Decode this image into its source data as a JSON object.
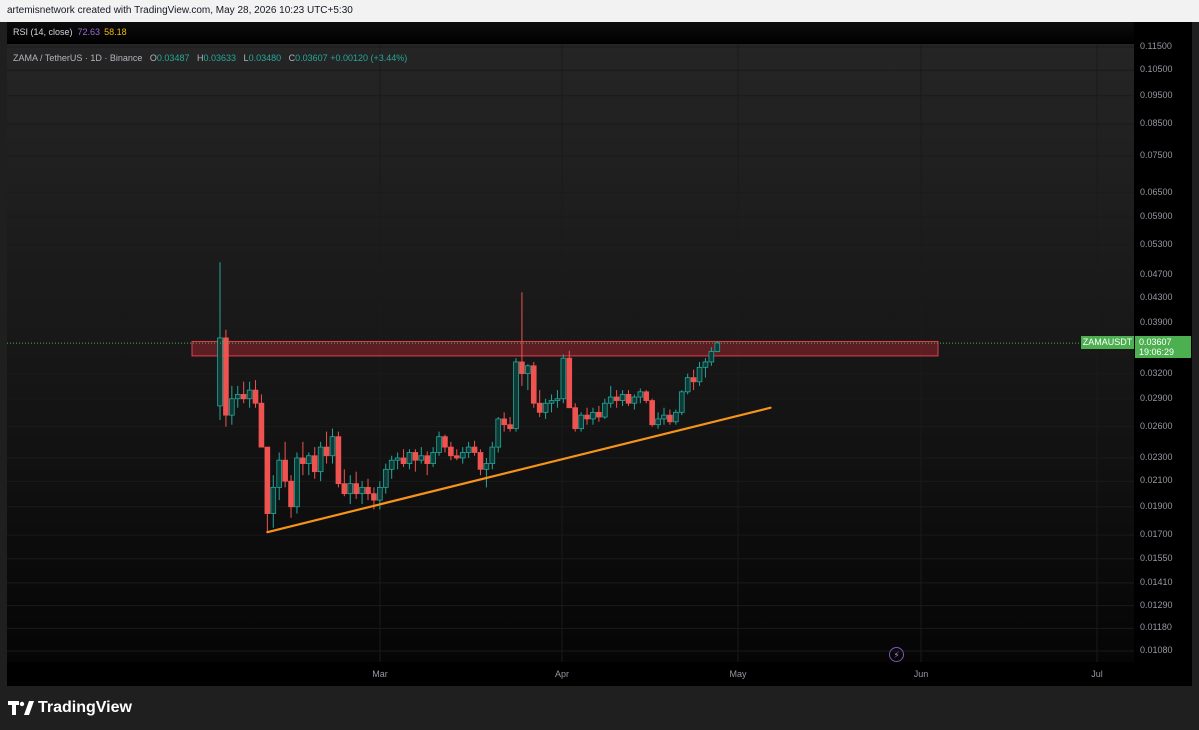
{
  "header": {
    "attribution": "artemisnetwork created with TradingView.com, May 28, 2026 10:23 UTC+5:30"
  },
  "rsi": {
    "label": "RSI (14, close)",
    "value": "72.63",
    "ma_value": "58.18"
  },
  "symbol": {
    "title": "ZAMA / TetherUS · 1D · Binance",
    "o_label": "O",
    "o_value": "0.03487",
    "h_label": "H",
    "h_value": "0.03633",
    "l_label": "L",
    "l_value": "0.03480",
    "c_label": "C",
    "c_value": "0.03607",
    "change": "+0.00120 (+3.44%)"
  },
  "price_tag": {
    "symbol": "ZAMAUSDT",
    "price": "0.03607",
    "countdown": "19:06:29"
  },
  "footer": {
    "brand": "TradingView"
  },
  "colors": {
    "up": "#26a69a",
    "down": "#ef5350",
    "trendline": "#f7931a",
    "resistance_zone": "#b22833",
    "price_tag": "#4caf50"
  },
  "chart_data": {
    "type": "candlestick",
    "scale": "log",
    "y_tick_labels": [
      "0.11500",
      "0.10500",
      "0.09500",
      "0.08500",
      "0.07500",
      "0.06500",
      "0.05900",
      "0.05300",
      "0.04700",
      "0.04300",
      "0.03900",
      "0.03200",
      "0.02900",
      "0.02600",
      "0.02300",
      "0.02100",
      "0.01900",
      "0.01700",
      "0.01550",
      "0.01410",
      "0.01290",
      "0.01180",
      "0.01080"
    ],
    "x_tick_labels": [
      "Mar",
      "Apr",
      "May",
      "Jun",
      "Jul"
    ],
    "last_price": 0.03607,
    "ohlc": [
      [
        0.0282,
        0.0495,
        0.0267,
        0.0368
      ],
      [
        0.0368,
        0.038,
        0.026,
        0.0272
      ],
      [
        0.0272,
        0.0305,
        0.0262,
        0.029
      ],
      [
        0.029,
        0.0305,
        0.028,
        0.0295
      ],
      [
        0.0295,
        0.031,
        0.0285,
        0.029
      ],
      [
        0.029,
        0.031,
        0.028,
        0.03
      ],
      [
        0.03,
        0.0312,
        0.028,
        0.0285
      ],
      [
        0.0285,
        0.0295,
        0.024,
        0.024
      ],
      [
        0.024,
        0.024,
        0.0172,
        0.0185
      ],
      [
        0.0185,
        0.0215,
        0.0175,
        0.0205
      ],
      [
        0.0205,
        0.0235,
        0.0195,
        0.0228
      ],
      [
        0.0228,
        0.0245,
        0.0205,
        0.021
      ],
      [
        0.021,
        0.0215,
        0.0182,
        0.019
      ],
      [
        0.019,
        0.0235,
        0.0185,
        0.023
      ],
      [
        0.023,
        0.0245,
        0.0215,
        0.0225
      ],
      [
        0.0225,
        0.0235,
        0.0215,
        0.0232
      ],
      [
        0.0232,
        0.024,
        0.0212,
        0.0218
      ],
      [
        0.0218,
        0.0245,
        0.021,
        0.024
      ],
      [
        0.024,
        0.0255,
        0.0225,
        0.0232
      ],
      [
        0.0232,
        0.0258,
        0.0225,
        0.025
      ],
      [
        0.025,
        0.0255,
        0.0205,
        0.0208
      ],
      [
        0.0208,
        0.022,
        0.0198,
        0.02
      ],
      [
        0.02,
        0.0215,
        0.0192,
        0.0208
      ],
      [
        0.0208,
        0.0218,
        0.0196,
        0.02
      ],
      [
        0.02,
        0.021,
        0.0192,
        0.0205
      ],
      [
        0.0205,
        0.0212,
        0.0195,
        0.02
      ],
      [
        0.02,
        0.0205,
        0.0188,
        0.0195
      ],
      [
        0.0195,
        0.021,
        0.0188,
        0.0205
      ],
      [
        0.0205,
        0.0225,
        0.02,
        0.022
      ],
      [
        0.022,
        0.0232,
        0.0212,
        0.0228
      ],
      [
        0.0228,
        0.0235,
        0.022,
        0.023
      ],
      [
        0.023,
        0.0238,
        0.0222,
        0.0225
      ],
      [
        0.0225,
        0.0238,
        0.022,
        0.0235
      ],
      [
        0.0235,
        0.0238,
        0.0218,
        0.0228
      ],
      [
        0.0228,
        0.024,
        0.0225,
        0.0232
      ],
      [
        0.0232,
        0.0236,
        0.0215,
        0.0225
      ],
      [
        0.0225,
        0.024,
        0.0222,
        0.0235
      ],
      [
        0.0235,
        0.0255,
        0.0232,
        0.025
      ],
      [
        0.025,
        0.0252,
        0.0235,
        0.024
      ],
      [
        0.024,
        0.0245,
        0.0228,
        0.0232
      ],
      [
        0.0232,
        0.0238,
        0.0228,
        0.023
      ],
      [
        0.023,
        0.024,
        0.0225,
        0.0235
      ],
      [
        0.0235,
        0.0245,
        0.023,
        0.024
      ],
      [
        0.024,
        0.0246,
        0.0232,
        0.0235
      ],
      [
        0.0235,
        0.0238,
        0.0215,
        0.022
      ],
      [
        0.022,
        0.023,
        0.0205,
        0.0225
      ],
      [
        0.0225,
        0.0245,
        0.022,
        0.024
      ],
      [
        0.024,
        0.027,
        0.0235,
        0.0268
      ],
      [
        0.0268,
        0.0275,
        0.0255,
        0.0262
      ],
      [
        0.0262,
        0.027,
        0.0255,
        0.0258
      ],
      [
        0.0258,
        0.034,
        0.0255,
        0.0335
      ],
      [
        0.0335,
        0.044,
        0.0305,
        0.032
      ],
      [
        0.032,
        0.0332,
        0.03,
        0.033
      ],
      [
        0.033,
        0.0335,
        0.028,
        0.0285
      ],
      [
        0.0285,
        0.03,
        0.027,
        0.0275
      ],
      [
        0.0275,
        0.029,
        0.0268,
        0.0285
      ],
      [
        0.0285,
        0.0295,
        0.0275,
        0.0288
      ],
      [
        0.0288,
        0.03,
        0.028,
        0.029
      ],
      [
        0.029,
        0.0345,
        0.0285,
        0.034
      ],
      [
        0.034,
        0.035,
        0.028,
        0.028
      ],
      [
        0.028,
        0.0285,
        0.0255,
        0.0258
      ],
      [
        0.0258,
        0.0275,
        0.0255,
        0.0272
      ],
      [
        0.0272,
        0.028,
        0.0262,
        0.0268
      ],
      [
        0.0268,
        0.028,
        0.0262,
        0.0275
      ],
      [
        0.0275,
        0.0282,
        0.0265,
        0.027
      ],
      [
        0.027,
        0.029,
        0.0268,
        0.0285
      ],
      [
        0.0285,
        0.0305,
        0.028,
        0.0292
      ],
      [
        0.0292,
        0.03,
        0.028,
        0.0288
      ],
      [
        0.0288,
        0.03,
        0.0282,
        0.0295
      ],
      [
        0.0295,
        0.03,
        0.0282,
        0.0285
      ],
      [
        0.0285,
        0.0295,
        0.0278,
        0.0292
      ],
      [
        0.0292,
        0.0302,
        0.0285,
        0.0298
      ],
      [
        0.0298,
        0.03,
        0.0285,
        0.0288
      ],
      [
        0.0288,
        0.029,
        0.026,
        0.0262
      ],
      [
        0.0262,
        0.0275,
        0.0258,
        0.0268
      ],
      [
        0.0268,
        0.028,
        0.0262,
        0.0272
      ],
      [
        0.0272,
        0.0278,
        0.0262,
        0.0265
      ],
      [
        0.0265,
        0.0278,
        0.0262,
        0.0275
      ],
      [
        0.0275,
        0.03,
        0.0272,
        0.0298
      ],
      [
        0.0298,
        0.032,
        0.0295,
        0.0315
      ],
      [
        0.0315,
        0.0325,
        0.03,
        0.031
      ],
      [
        0.031,
        0.0335,
        0.0305,
        0.0328
      ],
      [
        0.0328,
        0.034,
        0.0315,
        0.0335
      ],
      [
        0.0335,
        0.0355,
        0.033,
        0.0349
      ],
      [
        0.0349,
        0.0363,
        0.0348,
        0.0361
      ]
    ],
    "resistance_zone": [
      0.0343,
      0.0363
    ],
    "trendline": [
      [
        8,
        0.0172
      ],
      [
        93,
        0.028
      ]
    ]
  }
}
